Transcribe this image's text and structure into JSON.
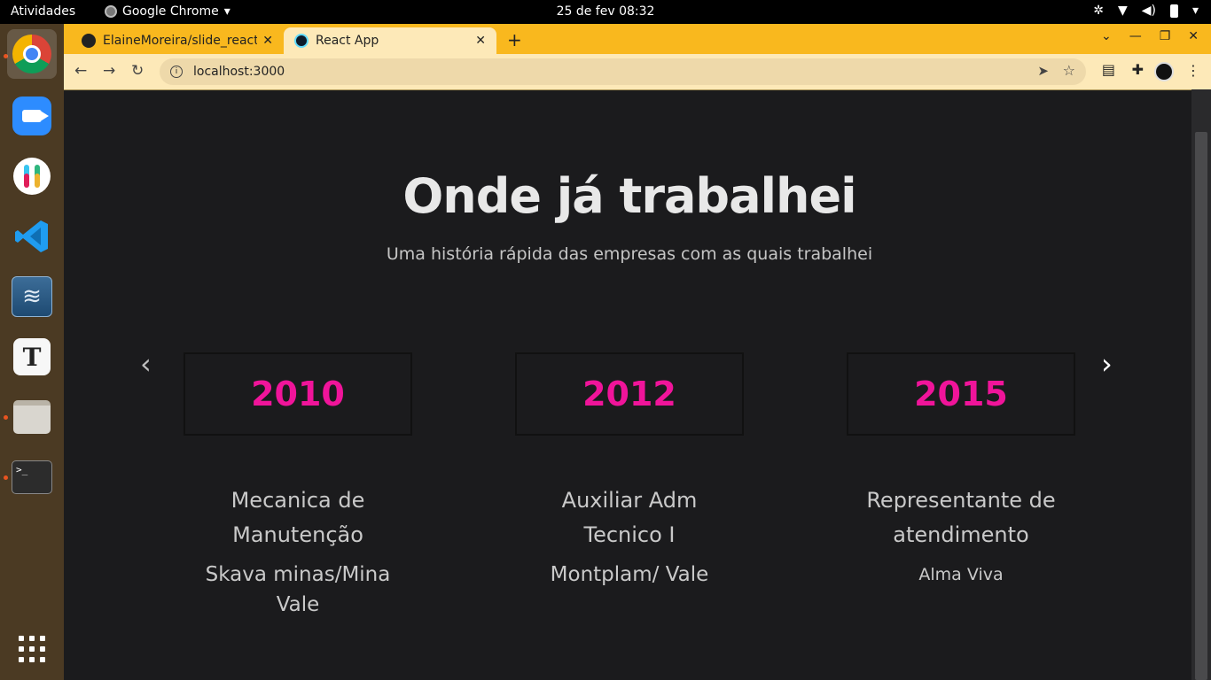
{
  "topbar": {
    "activities": "Atividades",
    "app_name": "Google Chrome",
    "clock": "25 de fev  08:32"
  },
  "dock": {
    "apps": [
      {
        "name": "chrome",
        "active": true
      },
      {
        "name": "zoom"
      },
      {
        "name": "slack"
      },
      {
        "name": "vscode"
      },
      {
        "name": "mysql-workbench"
      },
      {
        "name": "text-editor"
      },
      {
        "name": "files"
      },
      {
        "name": "terminal"
      }
    ],
    "terminal_prompt": ">_"
  },
  "browser": {
    "tabs": [
      {
        "title": "ElaineMoreira/slide_react",
        "icon": "github-icon"
      },
      {
        "title": "React App",
        "icon": "react-icon"
      }
    ],
    "url": "localhost:3000"
  },
  "page": {
    "title": "Onde já trabalhei",
    "subtitle": "Uma história rápida das empresas com as quais trabalhei",
    "jobs": [
      {
        "year": "2010",
        "role": "Mecanica de Manutenção",
        "company": "Skava minas/Mina Vale"
      },
      {
        "year": "2012",
        "role": "Auxiliar Adm Tecnico I",
        "company": "Montplam/ Vale"
      },
      {
        "year": "2015",
        "role": "Representante de atendimento",
        "company": "Alma Viva"
      }
    ]
  },
  "colors": {
    "accent": "#f0149a",
    "background": "#1b1b1d",
    "tabstrip": "#f9b81e"
  }
}
